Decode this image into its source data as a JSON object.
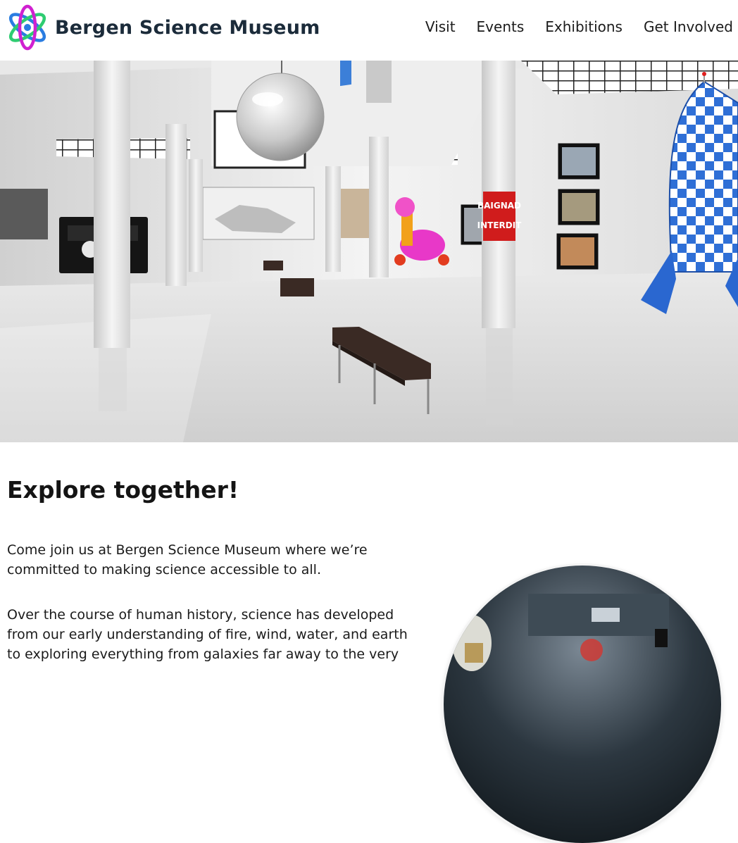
{
  "site": {
    "name": "Bergen Science Museum",
    "logo_icon": "atom-icon",
    "colors": {
      "logo_text": "#1b2b3a",
      "atom_green": "#2ecc71",
      "atom_blue": "#2a7de1",
      "atom_magenta": "#d020d0"
    }
  },
  "nav": {
    "items": [
      {
        "label": "Visit"
      },
      {
        "label": "Events"
      },
      {
        "label": "Exhibitions"
      },
      {
        "label": "Get Involved"
      }
    ]
  },
  "hero": {
    "scene": "museum-gallery-interior",
    "sign_text": "BAIGNAD INTERDIT"
  },
  "main": {
    "heading": "Explore together!",
    "paragraphs": [
      "Come join us at Bergen Science Museum where we’re committed to making science accessible to all.",
      "Over the course of human history, science has developed from our early understanding of fire, wind, water, and earth to exploring everything from galaxies far away to the very"
    ],
    "round_photo": "astronaut-helmet-photo"
  }
}
